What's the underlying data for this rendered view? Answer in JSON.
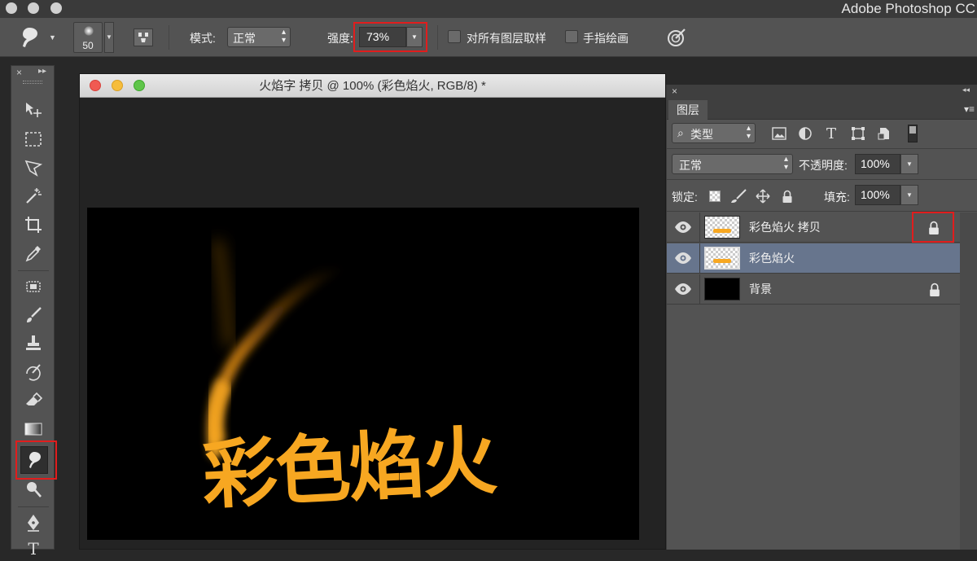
{
  "app": {
    "title": "Adobe Photoshop CC"
  },
  "options_bar": {
    "brush_size": "50",
    "mode_label": "模式:",
    "mode_value": "正常",
    "strength_label": "强度:",
    "strength_value": "73%",
    "sample_all_layers_label": "对所有图层取样",
    "finger_painting_label": "手指绘画"
  },
  "document": {
    "title": "火焰字 拷贝 @ 100% (彩色焰火, RGB/8) *",
    "canvas_text": "彩色焰火",
    "canvas_bg": "#000000",
    "text_color": "#f7a721"
  },
  "layers_panel": {
    "tab_label": "图层",
    "filter_kind": "类型",
    "blend_mode": "正常",
    "opacity_label": "不透明度:",
    "opacity_value": "100%",
    "lock_label": "锁定:",
    "fill_label": "填充:",
    "fill_value": "100%",
    "layers": [
      {
        "name": "彩色焰火 拷贝",
        "locked": true,
        "active": false,
        "visible": true
      },
      {
        "name": "彩色焰火",
        "locked": false,
        "active": true,
        "visible": true
      },
      {
        "name": "背景",
        "locked": true,
        "active": false,
        "visible": true
      }
    ]
  },
  "colors": {
    "highlight": "#e11d1d",
    "active_layer": "#67758d",
    "flame": "#f7a721"
  },
  "active_tool": "smudge-tool"
}
